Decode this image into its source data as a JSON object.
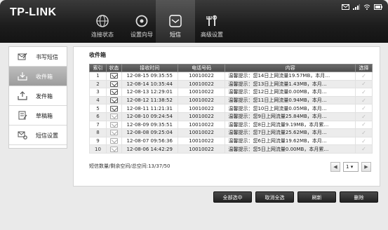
{
  "header": {
    "logo": "TP-LINK",
    "nav": [
      {
        "label": "连接状态",
        "icon": "globe-icon"
      },
      {
        "label": "设置向导",
        "icon": "wizard-icon"
      },
      {
        "label": "短信",
        "icon": "envelope-icon"
      },
      {
        "label": "高级设置",
        "icon": "tools-icon"
      }
    ],
    "status_icons": [
      "sms-icon",
      "signal-icon",
      "wifi-icon",
      "battery-icon"
    ]
  },
  "sidebar": {
    "items": [
      {
        "label": "书写短信",
        "icon": "compose-icon"
      },
      {
        "label": "收件箱",
        "icon": "inbox-icon"
      },
      {
        "label": "发件箱",
        "icon": "outbox-icon"
      },
      {
        "label": "草稿箱",
        "icon": "drafts-icon"
      },
      {
        "label": "短信设置",
        "icon": "sms-settings-icon"
      }
    ],
    "active_index": 1
  },
  "main": {
    "title": "收件箱",
    "columns": [
      "索引",
      "状态",
      "接收时间",
      "电话号码",
      "内容",
      "选择"
    ],
    "rows": [
      {
        "index": "1",
        "status": "unread",
        "time": "12-08-15 09:35:55",
        "phone": "10010022",
        "content": "温馨提示：您14日上网流量19.57MB，本月…"
      },
      {
        "index": "2",
        "status": "unread",
        "time": "12-08-14 10:35:44",
        "phone": "10010022",
        "content": "温馨提示：您13日上网流量1.43MB，本月…"
      },
      {
        "index": "3",
        "status": "unread",
        "time": "12-08-13 12:29:01",
        "phone": "10010022",
        "content": "温馨提示：您12日上网流量0.00MB，本月…"
      },
      {
        "index": "4",
        "status": "unread",
        "time": "12-08-12 11:38:52",
        "phone": "10010022",
        "content": "温馨提示：您11日上网流量0.94MB，本月…"
      },
      {
        "index": "5",
        "status": "unread",
        "time": "12-08-11 11:21:31",
        "phone": "10010022",
        "content": "温馨提示：您10日上网流量0.05MB，本月…"
      },
      {
        "index": "6",
        "status": "read",
        "time": "12-08-10 09:24:54",
        "phone": "10010022",
        "content": "温馨提示：您9日上网流量25.84MB，本月…"
      },
      {
        "index": "7",
        "status": "read",
        "time": "12-08-09 09:35:51",
        "phone": "10010022",
        "content": "温馨提示：您8日上网流量9.19MB，本月累…"
      },
      {
        "index": "8",
        "status": "read",
        "time": "12-08-08 09:25:04",
        "phone": "10010022",
        "content": "温馨提示：您7日上网流量25.62MB，本月…"
      },
      {
        "index": "9",
        "status": "read",
        "time": "12-08-07 09:56:36",
        "phone": "10010022",
        "content": "温馨提示：您6日上网流量19.62MB，本月…"
      },
      {
        "index": "10",
        "status": "read",
        "time": "12-08-06 14:42:29",
        "phone": "10010022",
        "content": "温馨提示：您5日上网流量0.00MB，本月累…"
      }
    ],
    "summary": "短信数量/剩余空间/总空间:13/37/50",
    "pager": {
      "current_page": "1"
    }
  },
  "buttons": {
    "select_all": "全部选中",
    "deselect_all": "取消全选",
    "refresh": "刷新",
    "delete": "删除"
  }
}
